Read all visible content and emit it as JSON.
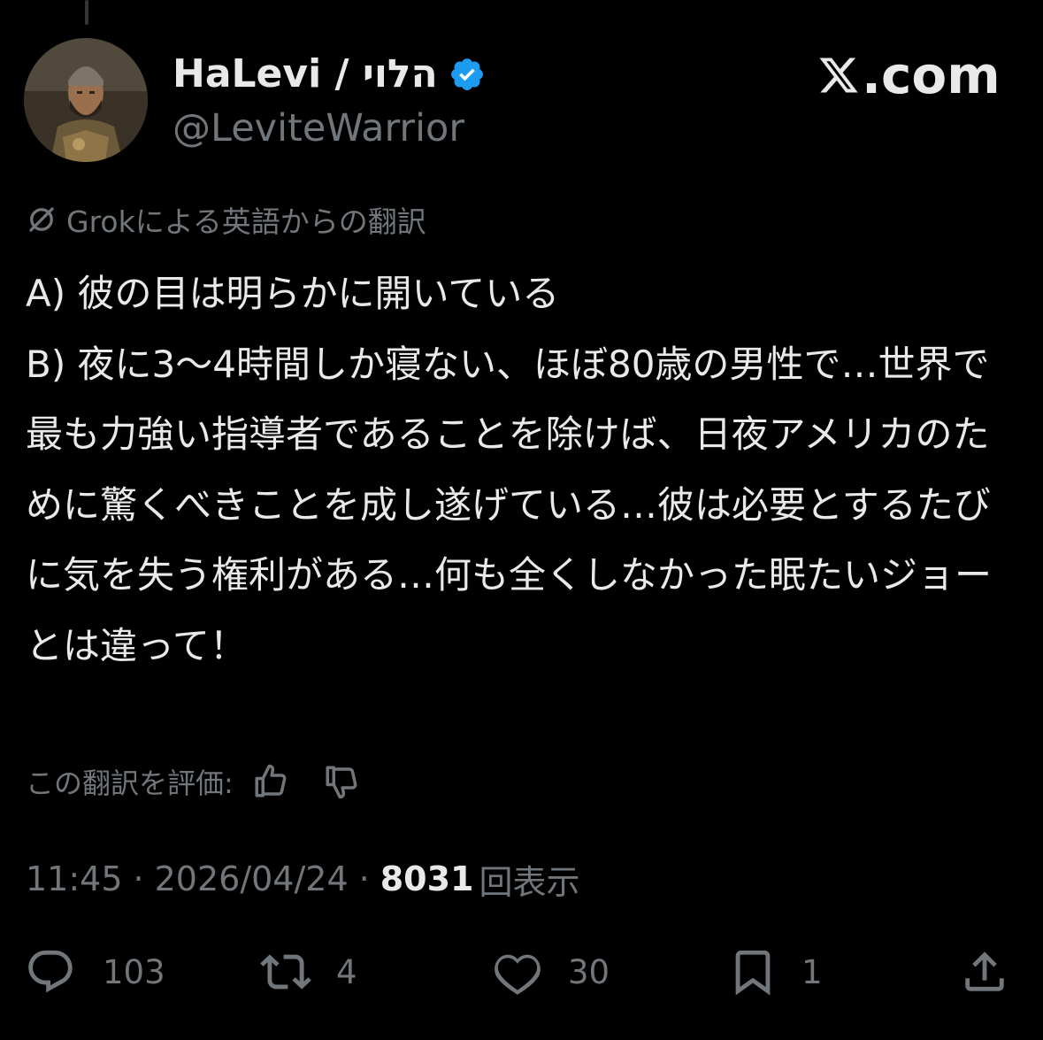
{
  "author": {
    "display_name": "HaLevi / הלוי",
    "handle": "@LeviteWarrior",
    "verified_icon": "verified-badge-icon",
    "verified_color": "#1d9bf0"
  },
  "watermark": {
    "text": ".com",
    "logo_icon": "x-logo-icon"
  },
  "translation": {
    "notice": "Grokによる英語からの翻訳",
    "icon": "grok-icon",
    "rate_label": "この翻訳を評価:",
    "rate_up_icon": "thumbs-up-icon",
    "rate_down_icon": "thumbs-down-icon"
  },
  "tweet": {
    "text": "A) 彼の目は明らかに開いている\nB) 夜に3〜4時間しか寝ない、ほぼ80歳の男性で…世界で最も力強い指導者であることを除けば、日夜アメリカのために驚くべきことを成し遂げている…彼は必要とするたびに気を失う権利がある…何も全くしなかった眠たいジョーとは違って！"
  },
  "meta": {
    "time": "11:45",
    "date": "2026/04/24",
    "separator": "·",
    "views_count": "8031",
    "views_label": "回表示"
  },
  "actions": {
    "reply": {
      "icon": "reply-icon",
      "count": "103"
    },
    "repost": {
      "icon": "repost-icon",
      "count": "4"
    },
    "like": {
      "icon": "heart-icon",
      "count": "30"
    },
    "bookmark": {
      "icon": "bookmark-icon",
      "count": "1"
    },
    "share": {
      "icon": "share-icon"
    }
  },
  "colors": {
    "background": "#000000",
    "primary_text": "#e7e9ea",
    "secondary_text": "#71767b",
    "accent": "#1d9bf0"
  }
}
